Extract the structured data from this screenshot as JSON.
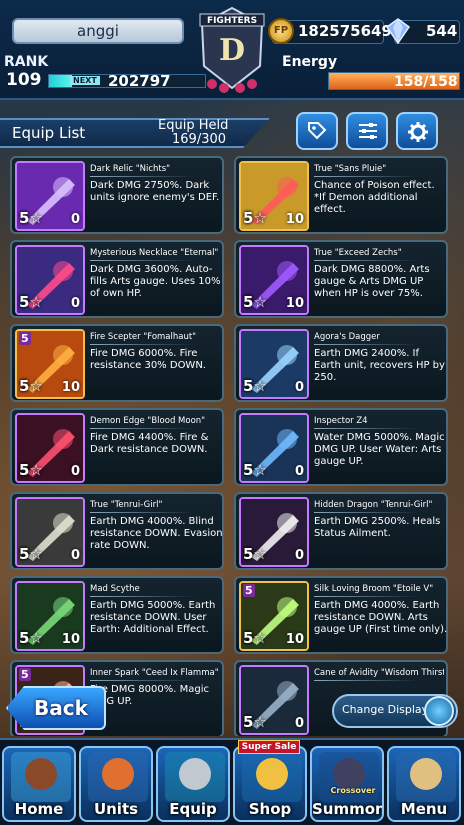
{
  "header": {
    "player_name": "anggi",
    "rank_label": "RANK",
    "rank": "109",
    "next_label": "NEXT",
    "next_exp": "202797",
    "xp_fraction": 0.15,
    "logo_text": "FIGHTERS",
    "logo_letter": "D",
    "coin_icon_text": "FP",
    "coins": "182575649",
    "gems": "544",
    "energy_label": "Energy",
    "energy": "158/158",
    "energy_fraction": 1.0
  },
  "equip_bar": {
    "title": "Equip List",
    "held_label": "Equip Held",
    "held_value": "169/300",
    "buttons": [
      "tag-icon",
      "sort-icon",
      "gear-icon"
    ]
  },
  "items": [
    {
      "name": "Dark Relic \"Nichts\"",
      "desc": "Dark DMG 2750%. Dark units ignore enemy's DEF.",
      "stars": "5",
      "count": "0",
      "rarity": "purple",
      "art": "dark-relic"
    },
    {
      "name": "True \"Sans Pluie\"",
      "desc": "Chance of Poison effect. *If Demon additional effect.",
      "stars": "5",
      "count": "10",
      "rarity": "gold",
      "art": "sans-pluie"
    },
    {
      "name": "Mysterious Necklace \"Eternal\"",
      "desc": "Dark DMG 3600%. Auto-fills Arts gauge. Uses 10% of own HP.",
      "stars": "5",
      "count": "0",
      "rarity": "purple",
      "art": "necklace"
    },
    {
      "name": "True \"Exceed Zechs\"",
      "desc": "Dark DMG 8800%. Arts gauge & Arts DMG UP when HP is over 75%.",
      "stars": "5",
      "count": "10",
      "rarity": "purple",
      "art": "exceed-zechs"
    },
    {
      "name": "Fire Scepter \"Fomalhaut\"",
      "desc": "Fire DMG 6000%. Fire resistance 30% DOWN.",
      "stars": "5",
      "count": "10",
      "rarity": "gold",
      "art": "fire-scepter",
      "limit": "5"
    },
    {
      "name": "Agora's Dagger",
      "desc": "Earth DMG 2400%. If Earth unit, recovers HP by 250.",
      "stars": "5",
      "count": "0",
      "rarity": "purple",
      "art": "dagger"
    },
    {
      "name": "Demon Edge \"Blood Moon\"",
      "desc": "Fire DMG 4400%. Fire & Dark resistance DOWN.",
      "stars": "5",
      "count": "0",
      "rarity": "purple",
      "art": "blood-moon"
    },
    {
      "name": "Inspector Z4",
      "desc": "Water DMG 5000%. Magic DMG UP. User Water: Arts gauge UP.",
      "stars": "5",
      "count": "0",
      "rarity": "purple",
      "art": "inspector"
    },
    {
      "name": "True \"Tenrui-Girl\"",
      "desc": "Earth DMG 4000%. Blind resistance DOWN. Evasion rate DOWN.",
      "stars": "5",
      "count": "0",
      "rarity": "purple",
      "art": "tenrui"
    },
    {
      "name": "Hidden Dragon \"Tenrui-Girl\"",
      "desc": "Earth DMG 2500%. Heals Status Ailment.",
      "stars": "5",
      "count": "0",
      "rarity": "purple",
      "art": "hidden-dragon"
    },
    {
      "name": "Mad Scythe",
      "desc": "Earth DMG 5000%. Earth resistance DOWN. User Earth: Additional Effect.",
      "stars": "5",
      "count": "10",
      "rarity": "purple",
      "art": "scythe"
    },
    {
      "name": "Silk Loving Broom \"Etoile V\"",
      "desc": "Earth DMG 4000%. Earth resistance DOWN. Arts gauge UP (First time only).",
      "stars": "5",
      "count": "10",
      "rarity": "gold",
      "art": "broom",
      "limit": "5"
    },
    {
      "name": "Inner Spark \"Ceed Ix Flamma\"",
      "desc": "Fire DMG 8000%. Magic DMG UP.",
      "stars": "5",
      "count": "0",
      "rarity": "purple",
      "art": "inner-spark",
      "limit": "5"
    },
    {
      "name": "Cane of Avidity \"Wisdom Thirst\"",
      "desc": "",
      "stars": "5",
      "count": "0",
      "rarity": "purple",
      "art": "cane"
    }
  ],
  "controls": {
    "back_label": "Back",
    "change_display_label": "Change Display"
  },
  "nav": {
    "items": [
      {
        "label": "Home",
        "icon": "house-icon"
      },
      {
        "label": "Units",
        "icon": "warrior-icon"
      },
      {
        "label": "Equip",
        "icon": "sword-icon"
      },
      {
        "label": "Shop",
        "icon": "treasure-icon"
      },
      {
        "label": "Summon",
        "icon": "hooded-figure-icon"
      },
      {
        "label": "Menu",
        "icon": "book-icon"
      }
    ],
    "sale_tag": "Super Sale",
    "crossover_tag": "Crossover"
  }
}
